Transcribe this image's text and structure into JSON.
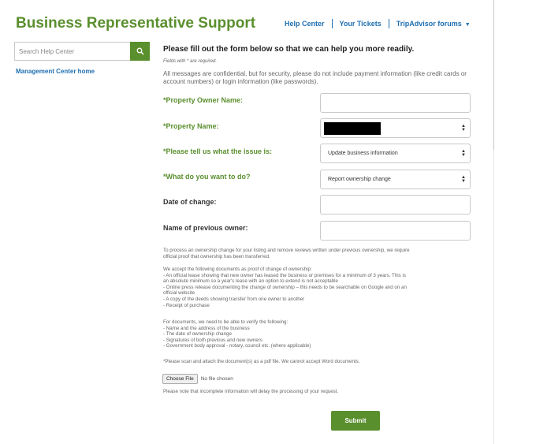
{
  "header": {
    "title": "Business Representative Support",
    "nav": {
      "help_center": "Help Center",
      "your_tickets": "Your Tickets",
      "forums": "TripAdvisor forums"
    }
  },
  "sidebar": {
    "search_placeholder": "Search Help Center",
    "management_link": "Management Center home"
  },
  "form": {
    "heading": "Please fill out the form below so that we can help you more readily.",
    "required_note": "Fields with * are required.",
    "confidential_note": "All messages are confidential, but for security, please do not include payment information (like credit cards or account numbers) or login information (like passwords).",
    "fields": {
      "owner_name_label": "*Property Owner Name:",
      "owner_name_value": "",
      "property_name_label": "*Property Name:",
      "issue_label": "*Please tell us what the issue is:",
      "issue_value": "Update business information",
      "action_label": "*What do you want to do?",
      "action_value": "Report ownership change",
      "date_label": "Date of change:",
      "date_value": "",
      "previous_owner_label": "Name of previous owner:",
      "previous_owner_value": ""
    },
    "info": {
      "intro_1": "To process an ownership change for your listing and remove reviews written under previous ownership, we require",
      "intro_2": "official proof that ownership has been transferred.",
      "accept_title": "We accept the following documents as proof of change of ownership:",
      "accept_1": "- An official lease showing that new owner has leased the business or premises for a minimum of 3 years. This is",
      "accept_1b": "an absolute minimum so a year's lease with an option to extend is not acceptable",
      "accept_2": "- Online press release documenting the change of ownership – this needs to be searchable on Google and on an",
      "accept_2b": "official website",
      "accept_3": "- A copy of the deeds showing transfer from one owner to another",
      "accept_4": "- Receipt of purchase",
      "verify_title": "For documents, we need to be able to verify the following:",
      "verify_1": "- Name and the address of the business",
      "verify_2": "- The date of ownership change",
      "verify_3": "- Signatures of both previous and new owners",
      "verify_4": "- Government body approval - notary, council etc. (where applicable)",
      "scan_note": "*Please scan and attach the document(s) as a pdf file. We cannot accept Word documents.",
      "incomplete_note": "Please note that incomplete information will delay the processing of your request."
    },
    "file": {
      "choose_label": "Choose File",
      "status": "No file chosen"
    },
    "submit_label": "Submit"
  },
  "colors": {
    "brand_green": "#5a8f2e",
    "link_blue": "#1f6fb2"
  }
}
